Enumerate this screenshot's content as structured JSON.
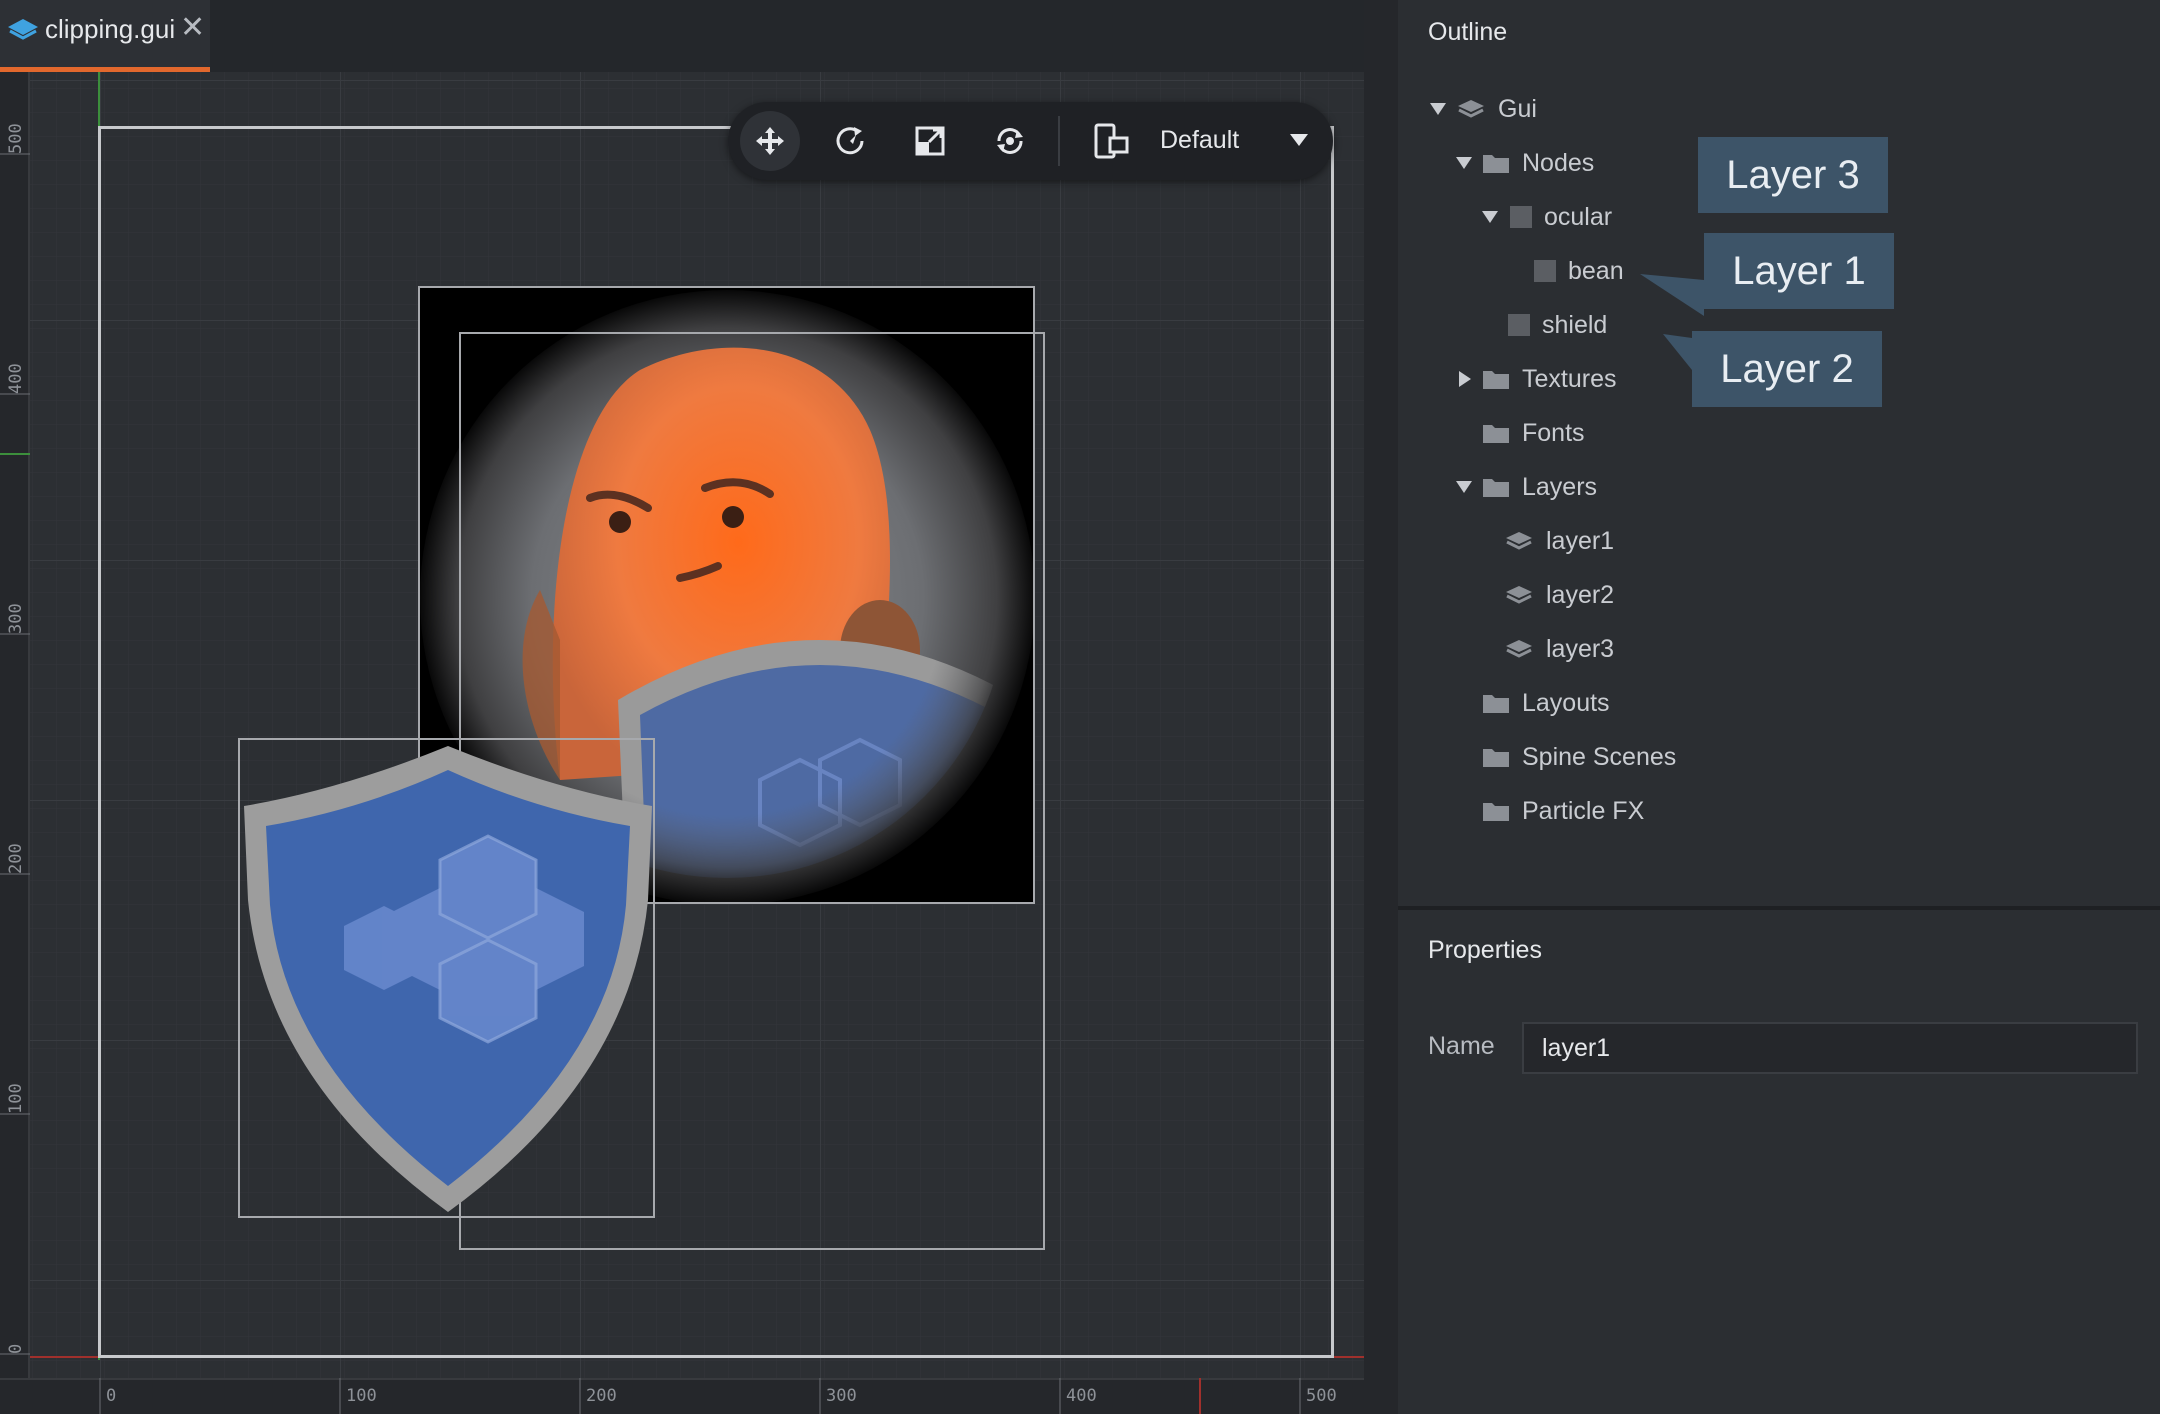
{
  "tab": {
    "title": "clipping.gui",
    "close_glyph": "✕"
  },
  "toolbar": {
    "tools": [
      "move-tool",
      "rotate-tool",
      "scale-tool",
      "reset-tool"
    ],
    "layout_selector": "Default"
  },
  "rulers": {
    "vertical": [
      "500",
      "400",
      "300",
      "200",
      "100",
      "0"
    ],
    "horizontal": [
      "0",
      "100",
      "200",
      "300",
      "400",
      "500"
    ]
  },
  "outline": {
    "title": "Outline",
    "items": [
      {
        "label": "Gui",
        "kind": "gui",
        "expanded": true
      },
      {
        "label": "Nodes",
        "kind": "folder",
        "expanded": true
      },
      {
        "label": "ocular",
        "kind": "node",
        "expanded": true
      },
      {
        "label": "bean",
        "kind": "node"
      },
      {
        "label": "shield",
        "kind": "node"
      },
      {
        "label": "Textures",
        "kind": "folder",
        "expanded": false
      },
      {
        "label": "Fonts",
        "kind": "folder"
      },
      {
        "label": "Layers",
        "kind": "folder",
        "expanded": true
      },
      {
        "label": "layer1",
        "kind": "layer"
      },
      {
        "label": "layer2",
        "kind": "layer"
      },
      {
        "label": "layer3",
        "kind": "layer"
      },
      {
        "label": "Layouts",
        "kind": "folder"
      },
      {
        "label": "Spine Scenes",
        "kind": "folder"
      },
      {
        "label": "Particle FX",
        "kind": "folder"
      }
    ],
    "callouts": {
      "ocular": "Layer 3",
      "bean": "Layer 1",
      "shield": "Layer 2"
    }
  },
  "properties": {
    "title": "Properties",
    "name_label": "Name",
    "name_value": "layer1"
  },
  "colors": {
    "accent": "#e2682d",
    "callout": "#3d5468",
    "shield": "#3f66ad",
    "bean": "#f0773a"
  }
}
